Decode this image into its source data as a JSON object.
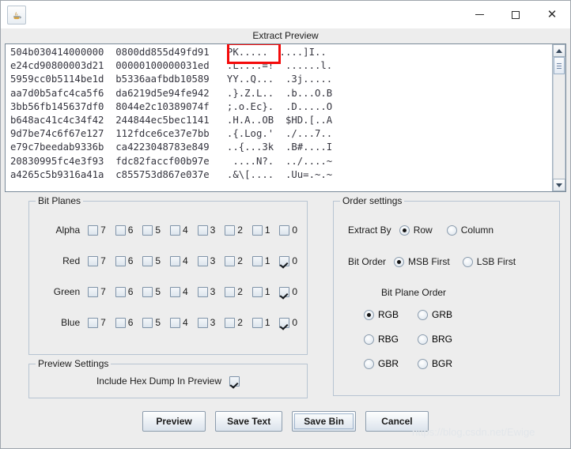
{
  "window": {
    "app_icon": "java-coffee-cup-icon",
    "minimize_label": "─",
    "maximize_label": "□",
    "close_label": "✕"
  },
  "dialog": {
    "title": "Extract Preview"
  },
  "preview": {
    "lines": [
      "504b030414000000  0800dd855d49fd91   PK.....  ....]I..",
      "e24cd90800003d21  00000100000031ed   .L....=!  ......l.",
      "5959cc0b5114be1d  b5336aafbdb10589   YY..Q...  .3j.....",
      "aa7d0b5afc4ca5f6  da6219d5e94fe942   .}.Z.L..  .b...O.B",
      "3bb56fb145637df0  8044e2c10389074f   ;.o.Ec}.  .D.....O",
      "b648ac41c4c34f42  244844ec5bec1141   .H.A..OB  $HD.[..A",
      "9d7be74c6f67e127  112fdce6ce37e7bb   .{.Log.'  ./...7..",
      "e79c7beedab9336b  ca4223048783e849   ..{...3k  .B#....I",
      "20830995fc4e3f93  fdc82faccf00b97e    ....N?.  ../....~",
      "a4265c5b9316a41a  c855753d867e037e   .&\\[....  .Uu=.~.~"
    ],
    "scroll_up": "scroll-up-arrow",
    "scroll_down": "scroll-down-arrow"
  },
  "bit_planes": {
    "legend": "Bit Planes",
    "bits": [
      "7",
      "6",
      "5",
      "4",
      "3",
      "2",
      "1",
      "0"
    ],
    "rows": [
      {
        "label": "Alpha",
        "checked": [
          false,
          false,
          false,
          false,
          false,
          false,
          false,
          false
        ]
      },
      {
        "label": "Red",
        "checked": [
          false,
          false,
          false,
          false,
          false,
          false,
          false,
          true
        ]
      },
      {
        "label": "Green",
        "checked": [
          false,
          false,
          false,
          false,
          false,
          false,
          false,
          true
        ]
      },
      {
        "label": "Blue",
        "checked": [
          false,
          false,
          false,
          false,
          false,
          false,
          false,
          true
        ]
      }
    ]
  },
  "order_settings": {
    "legend": "Order settings",
    "extract_by": {
      "label": "Extract By",
      "options": [
        "Row",
        "Column"
      ],
      "selected": "Row"
    },
    "bit_order": {
      "label": "Bit Order",
      "options": [
        "MSB First",
        "LSB First"
      ],
      "selected": "MSB First"
    },
    "bit_plane_order": {
      "label": "Bit Plane Order",
      "options": [
        "RGB",
        "GRB",
        "RBG",
        "BRG",
        "GBR",
        "BGR"
      ],
      "selected": "RGB"
    }
  },
  "preview_settings": {
    "legend": "Preview Settings",
    "include_hex_dump": {
      "label": "Include Hex Dump In Preview",
      "checked": true
    }
  },
  "buttons": [
    {
      "label": "Preview",
      "focused": false
    },
    {
      "label": "Save Text",
      "focused": false
    },
    {
      "label": "Save Bin",
      "focused": true
    },
    {
      "label": "Cancel",
      "focused": false
    }
  ],
  "watermark": "https://blog.csdn.net/Ewige",
  "colors": {
    "panel_bg": "#ededed",
    "annotation_red": "#f40b0b",
    "text": "#1b1b1b",
    "hex_text": "#35353f"
  }
}
